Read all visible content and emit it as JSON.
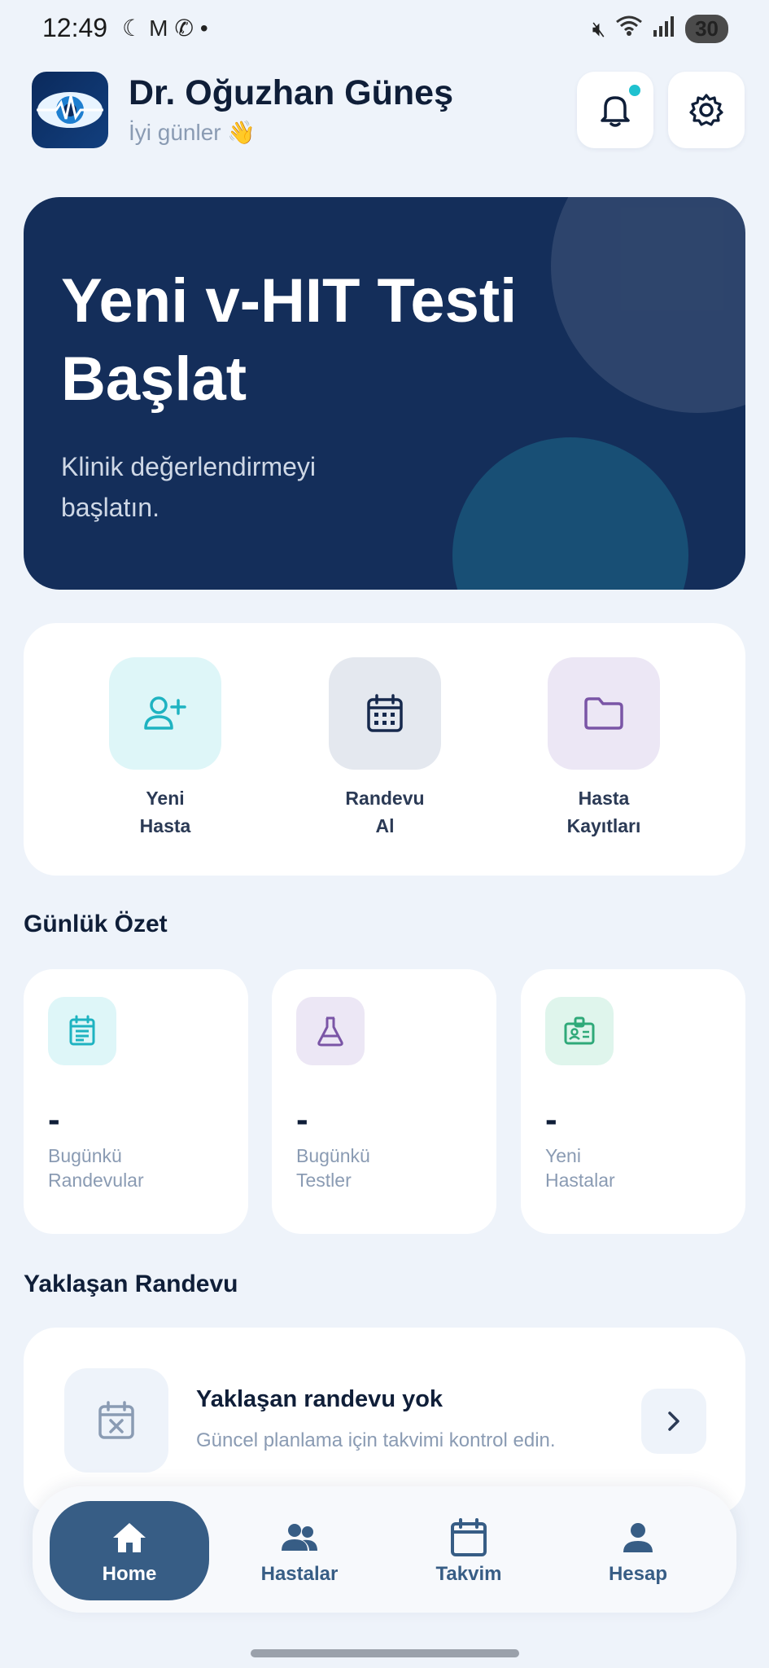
{
  "status_bar": {
    "time": "12:49",
    "battery": "30"
  },
  "header": {
    "doctor_name": "Dr. Oğuzhan Güneş",
    "greeting": "İyi günler 👋"
  },
  "hero": {
    "title": "Yeni v-HIT Testi Başlat",
    "subtitle": "Klinik değerlendirmeyi başlatın."
  },
  "quick_actions": [
    {
      "label": "Yeni\nHasta",
      "icon": "user-plus-icon",
      "bg": "#def6f8",
      "color": "#1eb3c1"
    },
    {
      "label": "Randevu\nAl",
      "icon": "calendar-icon",
      "bg": "#e4e8ef",
      "color": "#16294d"
    },
    {
      "label": "Hasta\nKayıtları",
      "icon": "folder-icon",
      "bg": "#ece7f5",
      "color": "#7a55a6"
    }
  ],
  "daily_summary": {
    "title": "Günlük Özet",
    "cards": [
      {
        "value": "-",
        "label": "Bugünkü\nRandevular",
        "icon": "clipboard-icon",
        "bg": "#def6f8",
        "color": "#1eb3c1"
      },
      {
        "value": "-",
        "label": "Bugünkü\nTestler",
        "icon": "flask-icon",
        "bg": "#ece7f5",
        "color": "#7a55a6"
      },
      {
        "value": "-",
        "label": "Yeni\nHastalar",
        "icon": "id-card-icon",
        "bg": "#dff5ec",
        "color": "#2fa979"
      }
    ]
  },
  "upcoming": {
    "title": "Yaklaşan Randevu",
    "empty_title": "Yaklaşan randevu yok",
    "empty_subtitle": "Güncel planlama için takvimi kontrol edin."
  },
  "bottom_nav": [
    {
      "label": "Home",
      "icon": "home-icon",
      "active": true
    },
    {
      "label": "Hastalar",
      "icon": "users-icon",
      "active": false
    },
    {
      "label": "Takvim",
      "icon": "calendar-icon",
      "active": false
    },
    {
      "label": "Hesap",
      "icon": "person-icon",
      "active": false
    }
  ],
  "colors": {
    "primary": "#142e5a",
    "accent": "#1fc1cf",
    "nav_active": "#375d85",
    "background": "#eef3fa"
  }
}
